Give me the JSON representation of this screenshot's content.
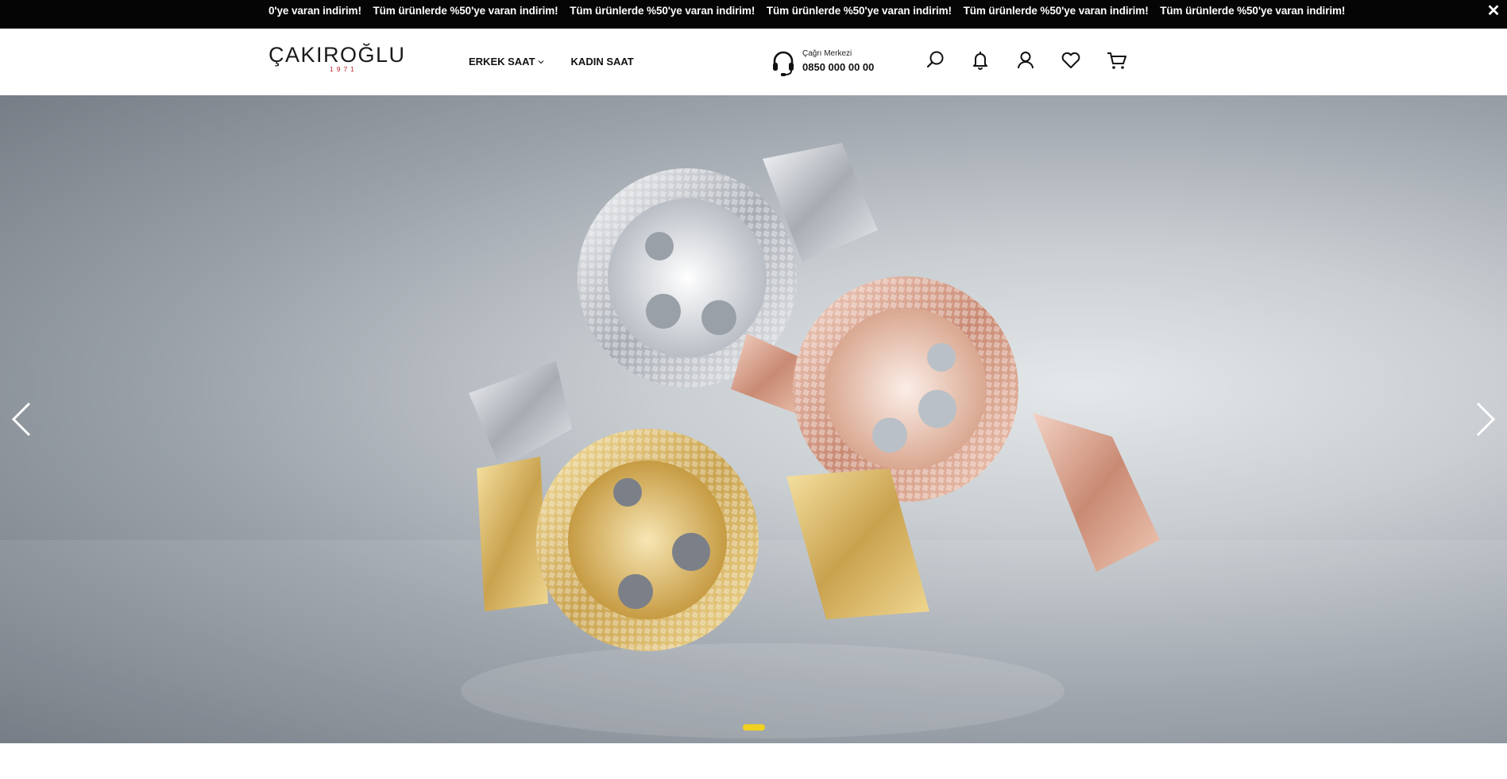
{
  "announcement": {
    "messages": [
      "0'ye varan indirim!",
      "Tüm ürünlerde %50'ye varan indirim!",
      "Tüm ürünlerde %50'ye varan indirim!",
      "Tüm ürünlerde %50'ye varan indirim!",
      "Tüm ürünlerde %50'ye varan indirim!",
      "Tüm ürünlerde %50'ye varan indirim!"
    ],
    "close_label": "✕"
  },
  "header": {
    "logo": {
      "name": "ÇAKIROĞLU",
      "year": "1971"
    },
    "nav": [
      {
        "label": "ERKEK SAAT",
        "has_dropdown": true
      },
      {
        "label": "KADIN SAAT",
        "has_dropdown": false
      }
    ],
    "call_center": {
      "label": "Çağrı Merkezi",
      "phone": "0850 000 00 00",
      "icon": "headset-icon"
    },
    "icons": [
      "search-icon",
      "bell-icon",
      "user-icon",
      "heart-icon",
      "cart-icon"
    ]
  },
  "hero": {
    "slide_image": "three Guess jewelled watches (silver, rose gold, gold)",
    "prev_icon": "chevron-left-icon",
    "next_icon": "chevron-right-icon",
    "active_slide": 1,
    "slide_count": 1,
    "dot_color": "#f0d020"
  },
  "colors": {
    "topbar_bg": "#050505",
    "accent_red": "#c0202a"
  }
}
